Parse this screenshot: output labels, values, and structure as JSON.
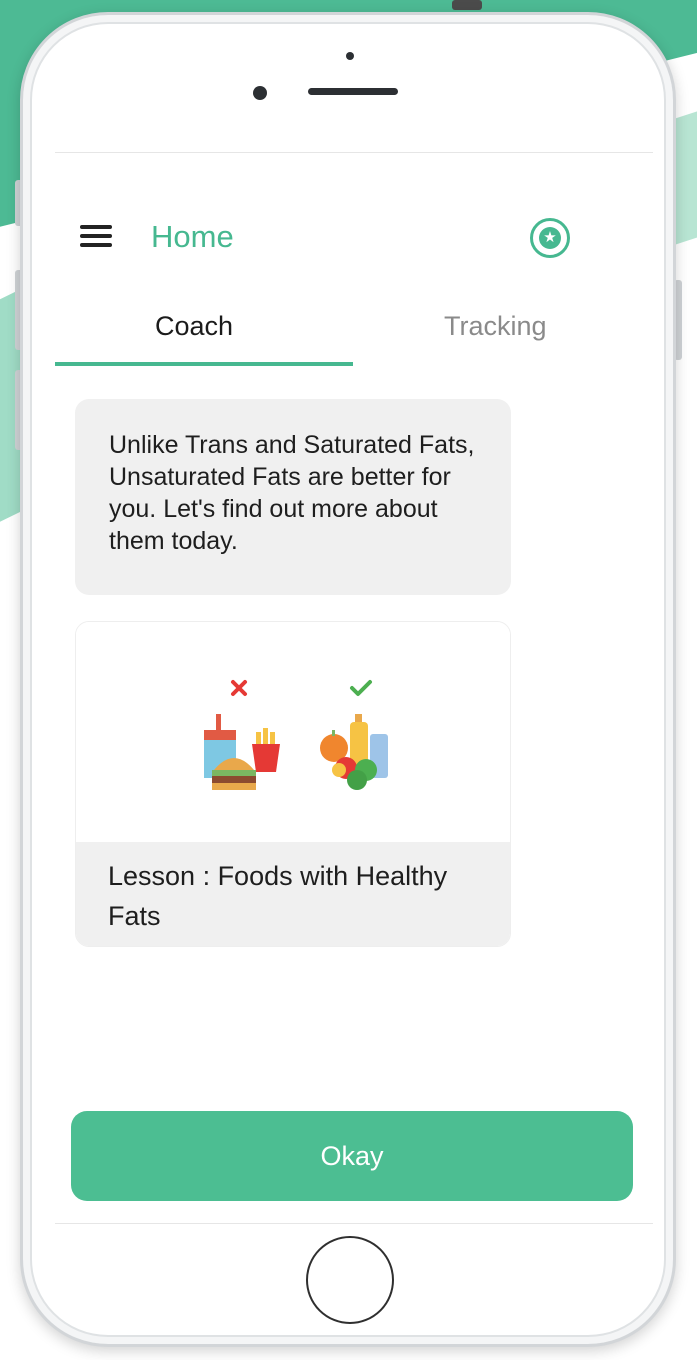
{
  "header": {
    "title": "Home"
  },
  "tabs": [
    {
      "label": "Coach",
      "active": true
    },
    {
      "label": "Tracking",
      "active": false
    }
  ],
  "coach": {
    "message": "Unlike Trans and Saturated Fats, Unsaturated Fats are better for you. Let's find out more about them today.",
    "lesson_title": "Lesson : Foods with Healthy Fats"
  },
  "actions": {
    "okay_label": "Okay"
  },
  "icons": {
    "menu": "hamburger-menu-icon",
    "favorite": "star-circle-icon",
    "unhealthy_mark": "cross-icon",
    "healthy_mark": "check-icon"
  },
  "colors": {
    "accent": "#46b890",
    "button": "#4cbe92",
    "bubble": "#f0f0f0",
    "cross": "#e53935",
    "check": "#4caf50"
  }
}
